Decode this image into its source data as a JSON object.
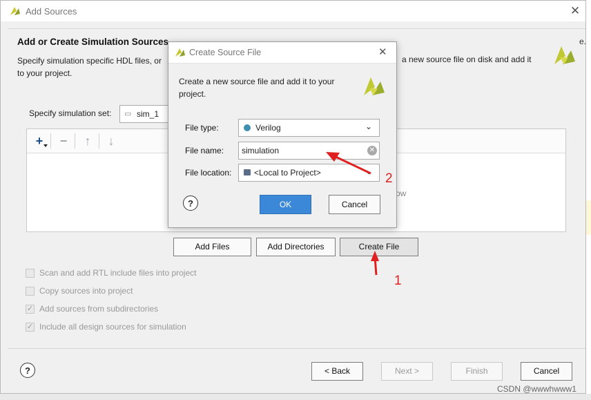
{
  "window": {
    "title": "Add Sources",
    "close_glyph": "✕"
  },
  "page": {
    "heading": "Add or Create Simulation Sources",
    "description_line1": "Specify simulation specific HDL files, or",
    "description_line1_tail": "a new source file on disk and add it",
    "description_line2": "to your project.",
    "sim_set_label": "Specify simulation set:",
    "sim_set_value": "sim_1",
    "panel_hint": "ow",
    "side_fragment": "e."
  },
  "toolbar": {
    "add_icon": "+",
    "remove_icon": "−",
    "up_icon": "↑",
    "down_icon": "↓"
  },
  "buttons": {
    "add_files": "Add Files",
    "add_directories": "Add Directories",
    "create_file": "Create File",
    "back": "< Back",
    "next": "Next >",
    "finish": "Finish",
    "cancel": "Cancel"
  },
  "options": [
    {
      "label": "Scan and add RTL include files into project",
      "checked": false
    },
    {
      "label": "Copy sources into project",
      "checked": false
    },
    {
      "label": "Add sources from subdirectories",
      "checked": true
    },
    {
      "label": "Include all design sources for simulation",
      "checked": true
    }
  ],
  "dialog": {
    "title": "Create Source File",
    "close_glyph": "✕",
    "description_line1": "Create a new source file and add it to your",
    "description_line2": "project.",
    "file_type_label": "File type:",
    "file_type_value": "Verilog",
    "file_name_label": "File name:",
    "file_name_value": "simulation",
    "file_location_label": "File location:",
    "file_location_value": "<Local to Project>",
    "ok": "OK",
    "cancel": "Cancel"
  },
  "annotations": {
    "arrow1_label": "1",
    "arrow2_label": "2"
  },
  "watermark": "CSDN @wwwhwww1",
  "colors": {
    "accent_blue": "#3b87d8",
    "verilog_dot": "#3e8fb0",
    "logo_yellow": "#b8c430",
    "annotation_red": "#e02020"
  }
}
